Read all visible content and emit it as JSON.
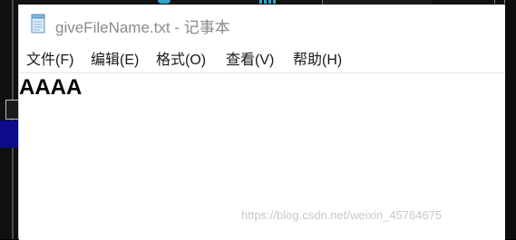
{
  "window": {
    "title": "giveFileName.txt - 记事本",
    "icon": "notepad-icon"
  },
  "menu": {
    "items": [
      {
        "label": "文件(F)"
      },
      {
        "label": "编辑(E)"
      },
      {
        "label": "格式(O)"
      },
      {
        "label": "查看(V)"
      },
      {
        "label": "帮助(H)"
      }
    ]
  },
  "editor": {
    "content": "AAAA"
  },
  "watermark": {
    "text": "https://blog.csdn.net/weixin_45764675"
  },
  "colors": {
    "title_text": "#8a8a8a",
    "background_app": "#000000",
    "selection_blue": "#0b0b8c"
  }
}
